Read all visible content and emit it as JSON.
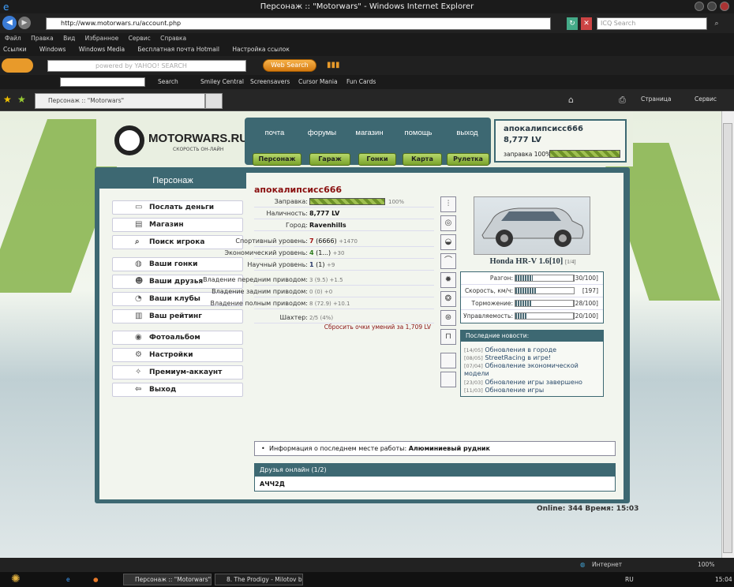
{
  "browser": {
    "title": "Персонаж :: \"Motorwars\" - Windows Internet Explorer",
    "url": "http://www.motorwars.ru/account.php",
    "search_placeholder": "ICQ Search",
    "menu": [
      "Файл",
      "Правка",
      "Вид",
      "Избранное",
      "Сервис",
      "Справка"
    ],
    "links": [
      "Ссылки",
      "Windows",
      "Windows Media",
      "Бесплатная почта Hotmail",
      "Настройка ссылок"
    ],
    "yahoo_placeholder": "powered by YAHOO! SEARCH",
    "web_search": "Web Search",
    "toolbar2": [
      "Search",
      "Smiley Central",
      "Screensavers",
      "Cursor Mania",
      "Fun Cards"
    ],
    "tab": "Персонаж :: \"Motorwars\"",
    "tab_tools": [
      "Страница",
      "Сервис"
    ],
    "status": "Интернет",
    "zoom": "100%"
  },
  "taskbar": {
    "items": [
      "Персонаж :: \"Motorwars\" -...",
      "8. The Prodigy - Milotov bit..."
    ],
    "lang": "RU",
    "clock": "15:04"
  },
  "site": {
    "logo": "MOTORWARS.RU",
    "logo_sub": "СКОРОСТЬ ОН-ЛАЙН",
    "nav_links": [
      "почта",
      "форумы",
      "магазин",
      "помощь",
      "выход"
    ],
    "nav_buttons": [
      "Персонаж",
      "Гараж",
      "Гонки",
      "Карта",
      "Рулетка"
    ],
    "user": {
      "name": "апокалипсисс666",
      "money": "8,777 LV",
      "fuel": "заправка 100%"
    }
  },
  "sidebar": {
    "title": "Персонаж",
    "groups": [
      [
        {
          "label": "Послать деньги",
          "icon": "money-icon"
        },
        {
          "label": "Магазин",
          "icon": "shop-icon"
        },
        {
          "label": "Поиск игрока",
          "icon": "search-icon"
        }
      ],
      [
        {
          "label": "Ваши гонки",
          "icon": "car-icon"
        },
        {
          "label": "Ваши друзья",
          "icon": "friends-icon"
        },
        {
          "label": "Ваши клубы",
          "icon": "club-icon"
        },
        {
          "label": "Ваш рейтинг",
          "icon": "rating-icon"
        }
      ],
      [
        {
          "label": "Фотоальбом",
          "icon": "camera-icon"
        },
        {
          "label": "Настройки",
          "icon": "settings-icon"
        },
        {
          "label": "Премиум-аккаунт",
          "icon": "premium-icon"
        },
        {
          "label": "Выход",
          "icon": "exit-icon"
        }
      ]
    ]
  },
  "character": {
    "name": "апокалипсисс666",
    "fuel_label": "Заправка:",
    "fuel_pct": "100%",
    "money_label": "Наличность:",
    "money": "8,777 LV",
    "city_label": "Город:",
    "city": "Ravenhills",
    "sport_label": "Спортивный уровень:",
    "sport_level": "7",
    "sport_points": "(6666)",
    "sport_plus": "+1470",
    "econ_label": "Экономический уровень:",
    "econ_level": "4",
    "econ_points": "(1...)",
    "econ_plus": "+30",
    "sci_label": "Научный уровень:",
    "sci_level": "1",
    "sci_points": "(1)",
    "sci_plus": "+9",
    "fwd_label": "Владение передним приводом:",
    "fwd": "3",
    "fwd_points": "(9.5)",
    "fwd_plus": "+1.5",
    "rwd_label": "Владение задним приводом:",
    "rwd": "0",
    "rwd_points": "(0)",
    "rwd_plus": "+0",
    "awd_label": "Владение полным приводом:",
    "awd": "8",
    "awd_points": "(72.9)",
    "awd_plus": "+10.1",
    "mine_label": "Шахтер:",
    "mine": "2/5",
    "mine_pct": "(4%)",
    "reset": "Сбросить очки умений за 1,709 LV"
  },
  "slots": [
    "suspension-icon",
    "tire-icon",
    "exhaust-icon",
    "spoiler-icon",
    "engine-icon",
    "wheel-icon",
    "turbo-icon",
    "seat-icon",
    "",
    ""
  ],
  "car": {
    "name": "Honda HR-V 1.6[10]",
    "count": "[1/4]",
    "stats": [
      {
        "label": "Разгон:",
        "value": "[30/100]",
        "level": 0.3
      },
      {
        "label": "Скорость, км/ч:",
        "value": "[197]",
        "level": 0.35
      },
      {
        "label": "Торможение:",
        "value": "[28/100]",
        "level": 0.28
      },
      {
        "label": "Управляемость:",
        "value": "[20/100]",
        "level": 0.2
      }
    ]
  },
  "news": {
    "title": "Последние новости:",
    "items": [
      {
        "date": "[14/05]",
        "text": "Обновления в городе"
      },
      {
        "date": "[08/05]",
        "text": "StreetRacing в игре!"
      },
      {
        "date": "[07/04]",
        "text": "Обновление экономической модели"
      },
      {
        "date": "[23/03]",
        "text": "Обновление игры завершено"
      },
      {
        "date": "[11/03]",
        "text": "Обновление игры"
      }
    ]
  },
  "work": {
    "label": "Информация о последнем месте работы:",
    "value": "Алюминиевый рудник"
  },
  "friends": {
    "title": "Друзья онлайн (1/2)",
    "list": "АЧЧ2Д"
  },
  "footer": {
    "online_label": "Online:",
    "online": "344",
    "time_label": "Время:",
    "time": "15:03"
  }
}
